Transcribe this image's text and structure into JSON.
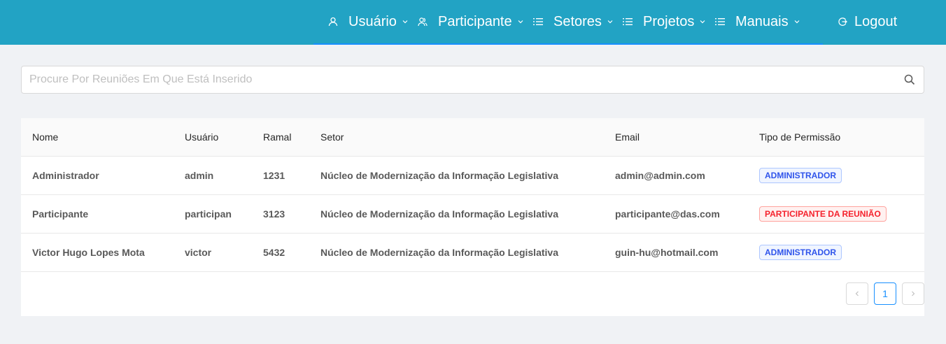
{
  "nav": {
    "usuario": "Usuário",
    "participante": "Participante",
    "setores": "Setores",
    "projetos": "Projetos",
    "manuais": "Manuais",
    "logout": "Logout"
  },
  "search": {
    "placeholder": "Procure Por Reuniões Em Que Está Inserido",
    "value": ""
  },
  "table": {
    "headers": [
      "Nome",
      "Usuário",
      "Ramal",
      "Setor",
      "Email",
      "Tipo de Permissão"
    ],
    "rows": [
      [
        "Administrador",
        "admin",
        "1231",
        "Núcleo de Modernização da Informação Legislativa",
        "admin@admin.com",
        "ADMINISTRADOR"
      ],
      [
        "Participante",
        "participan",
        "3123",
        "Núcleo de Modernização da Informação Legislativa",
        "participante@das.com",
        "PARTICIPANTE DA REUNIÃO"
      ],
      [
        "Victor Hugo Lopes Mota",
        "victor",
        "5432",
        "Núcleo de Modernização da Informação Legislativa",
        "guin-hu@hotmail.com",
        "ADMINISTRADOR"
      ]
    ]
  },
  "pagination": {
    "current_page": "1"
  },
  "colors": {
    "header_bg": "#22a3c4",
    "accent": "#1890ff",
    "admin_tag": "#2f54eb",
    "participant_tag": "#f5222d"
  }
}
